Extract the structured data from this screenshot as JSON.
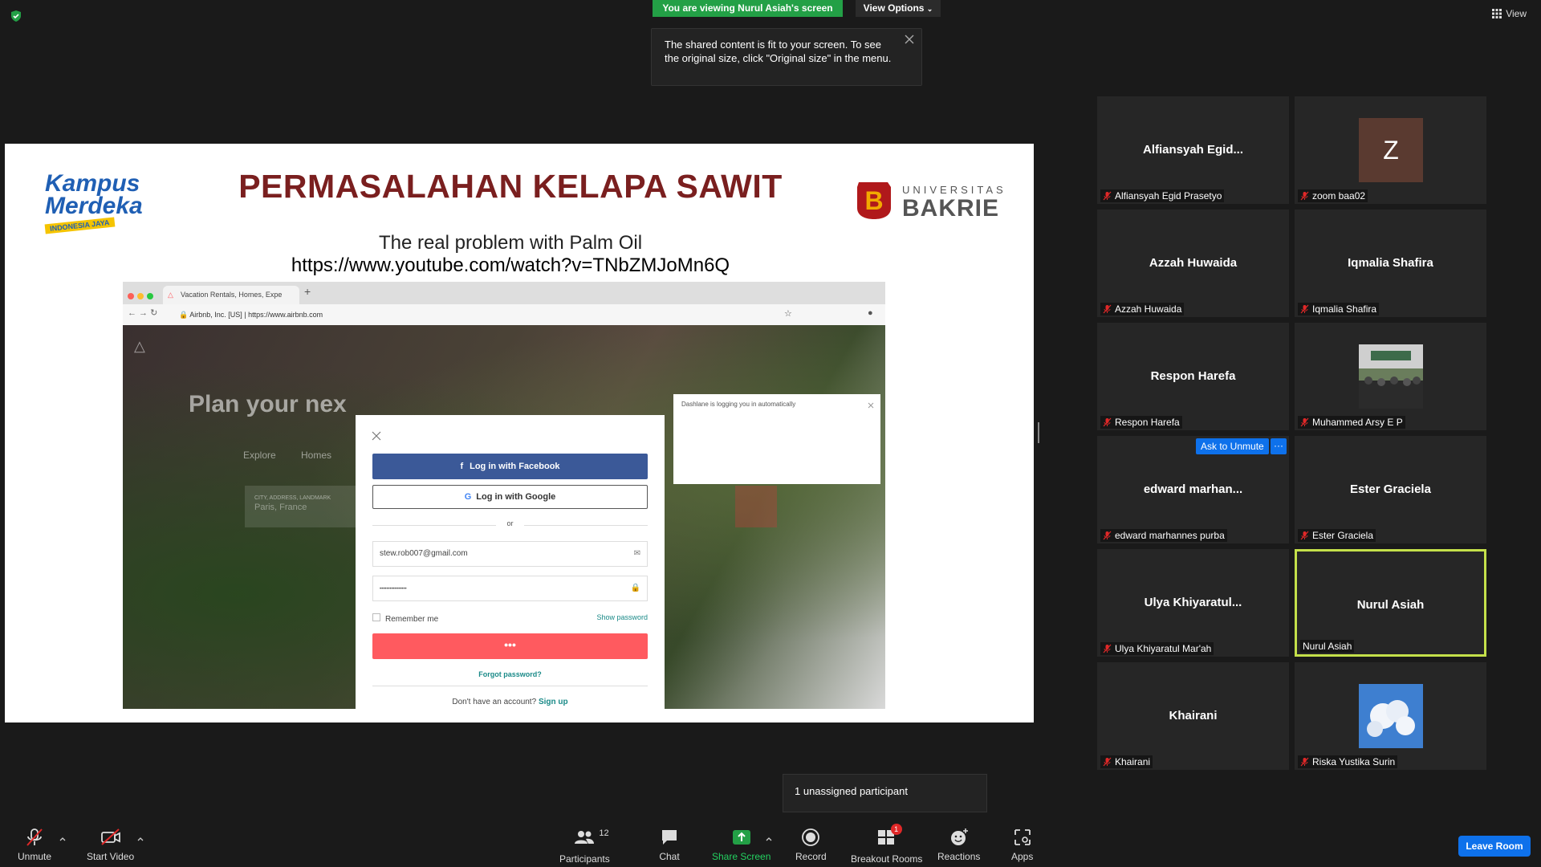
{
  "top": {
    "viewing_banner": "You are viewing Nurul Asiah's screen",
    "view_options": "View Options",
    "view": "View",
    "tooltip": "The shared content is fit to your screen. To see the original size, click \"Original size\" in the menu."
  },
  "slide": {
    "logo_left_line1": "Kampus",
    "logo_left_line2": "Merdeka",
    "logo_left_line3": "INDONESIA JAYA",
    "title": "PERMASALAHAN KELAPA SAWIT",
    "logo_right_line1": "UNIVERSITAS",
    "logo_right_line2": "BAKRIE",
    "subtitle": "The real problem with Palm Oil",
    "url": "https://www.youtube.com/watch?v=TNbZMJoMn6Q",
    "browser": {
      "tab_title": "Vacation Rentals, Homes, Expe",
      "address_company": "Airbnb, Inc. [US]",
      "address_url": "https://www.airbnb.com",
      "page_heading": "Plan your nex",
      "nav_explore": "Explore",
      "nav_homes": "Homes",
      "search_label": "CITY, ADDRESS, LANDMARK",
      "search_placeholder": "Paris, France",
      "modal": {
        "facebook": "Log in with Facebook",
        "google": "Log in with Google",
        "or": "or",
        "email": "stew.rob007@gmail.com",
        "password": "••••••••••••••••",
        "remember": "Remember me",
        "show_password": "Show password",
        "login_dots": "•••",
        "forgot": "Forgot password?",
        "no_account": "Don't have an account?",
        "signup": "Sign up"
      },
      "dashlane": "Dashlane is logging you in automatically"
    }
  },
  "participants": [
    {
      "tile_name": "Alfiansyah  Egid...",
      "label": "Alfiansyah Egid Prasetyo",
      "muted": true
    },
    {
      "tile_name": "",
      "avatar": "Z",
      "label": "zoom baa02",
      "muted": true
    },
    {
      "tile_name": "Azzah Huwaida",
      "label": "Azzah Huwaida",
      "muted": true
    },
    {
      "tile_name": "Iqmalia Shafira",
      "label": "Iqmalia Shafira",
      "muted": true
    },
    {
      "tile_name": "Respon Harefa",
      "label": "Respon Harefa",
      "muted": true
    },
    {
      "tile_name": "",
      "photo": "group-photo",
      "label": "Muhammed Arsy E P",
      "muted": true
    },
    {
      "tile_name": "edward  marhan...",
      "label": "edward marhannes purba",
      "muted": true
    },
    {
      "tile_name": "Ester Graciela",
      "label": "Ester Graciela",
      "muted": true
    },
    {
      "tile_name": "Ulya  Khiyaratul...",
      "label": "Ulya Khiyaratul Mar'ah",
      "muted": true
    },
    {
      "tile_name": "Nurul Asiah",
      "label": "Nurul Asiah",
      "muted": false,
      "active": true
    },
    {
      "tile_name": "Khairani",
      "label": "Khairani",
      "muted": true
    },
    {
      "tile_name": "",
      "photo": "sky-photo",
      "label": "Riska Yustika Surin",
      "muted": true
    }
  ],
  "ask_unmute": "Ask to Unmute",
  "more": "···",
  "unassigned": "1 unassigned participant",
  "toolbar": {
    "unmute": "Unmute",
    "start_video": "Start Video",
    "participants": "Participants",
    "participants_count": "12",
    "chat": "Chat",
    "share_screen": "Share Screen",
    "record": "Record",
    "breakout_rooms": "Breakout Rooms",
    "breakout_badge": "1",
    "reactions": "Reactions",
    "apps": "Apps",
    "leave": "Leave Room"
  },
  "colors": {
    "share_green": "#23a046",
    "zoom_blue": "#0e71eb",
    "active_speaker": "#c4e04a",
    "title_maroon": "#7a1f1f",
    "mute_red": "#e02828"
  }
}
